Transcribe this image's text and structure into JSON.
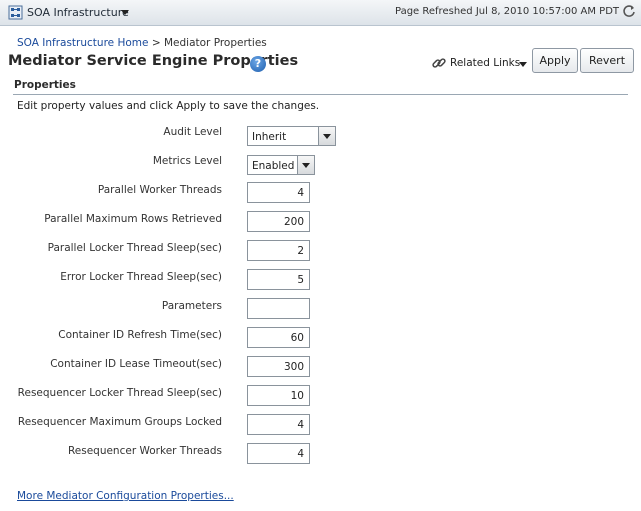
{
  "app": {
    "title": "SOA Infrastructure",
    "page_refreshed": "Page Refreshed Jul 8, 2010 10:57:00 AM PDT"
  },
  "breadcrumb": {
    "home": "SOA Infrastructure Home",
    "separator": ">",
    "current": "Mediator Properties"
  },
  "page": {
    "title": "Mediator Service Engine Properties",
    "help": "?",
    "related_links": "Related Links",
    "apply": "Apply",
    "revert": "Revert"
  },
  "section": {
    "title": "Properties",
    "instructions": "Edit property values and click Apply to save the changes."
  },
  "properties": {
    "audit_level": {
      "label": "Audit Level",
      "value": "Inherit"
    },
    "metrics_level": {
      "label": "Metrics Level",
      "value": "Enabled"
    },
    "parallel_worker_threads": {
      "label": "Parallel Worker Threads",
      "value": "4"
    },
    "parallel_maximum_rows_retrieved": {
      "label": "Parallel Maximum Rows Retrieved",
      "value": "200"
    },
    "parallel_locker_thread_sleep": {
      "label": "Parallel Locker Thread Sleep(sec)",
      "value": "2"
    },
    "error_locker_thread_sleep": {
      "label": "Error Locker Thread Sleep(sec)",
      "value": "5"
    },
    "parameters": {
      "label": "Parameters",
      "value": ""
    },
    "container_id_refresh_time": {
      "label": "Container ID Refresh Time(sec)",
      "value": "60"
    },
    "container_id_lease_timeout": {
      "label": "Container ID Lease Timeout(sec)",
      "value": "300"
    },
    "resequencer_locker_thread_sleep": {
      "label": "Resequencer Locker Thread Sleep(sec)",
      "value": "10"
    },
    "resequencer_maximum_groups_locked": {
      "label": "Resequencer Maximum Groups Locked",
      "value": "4"
    },
    "resequencer_worker_threads": {
      "label": "Resequencer Worker Threads",
      "value": "4"
    }
  },
  "footer": {
    "more_link": "More Mediator Configuration Properties..."
  },
  "colors": {
    "link": "#1a4a9b",
    "topbar": "#dde3e9",
    "help_icon": "#1f5fae"
  },
  "icons": {
    "app": "grid-nodes-icon",
    "refresh": "refresh-icon",
    "help": "help-icon",
    "related": "chain-link-icon"
  }
}
